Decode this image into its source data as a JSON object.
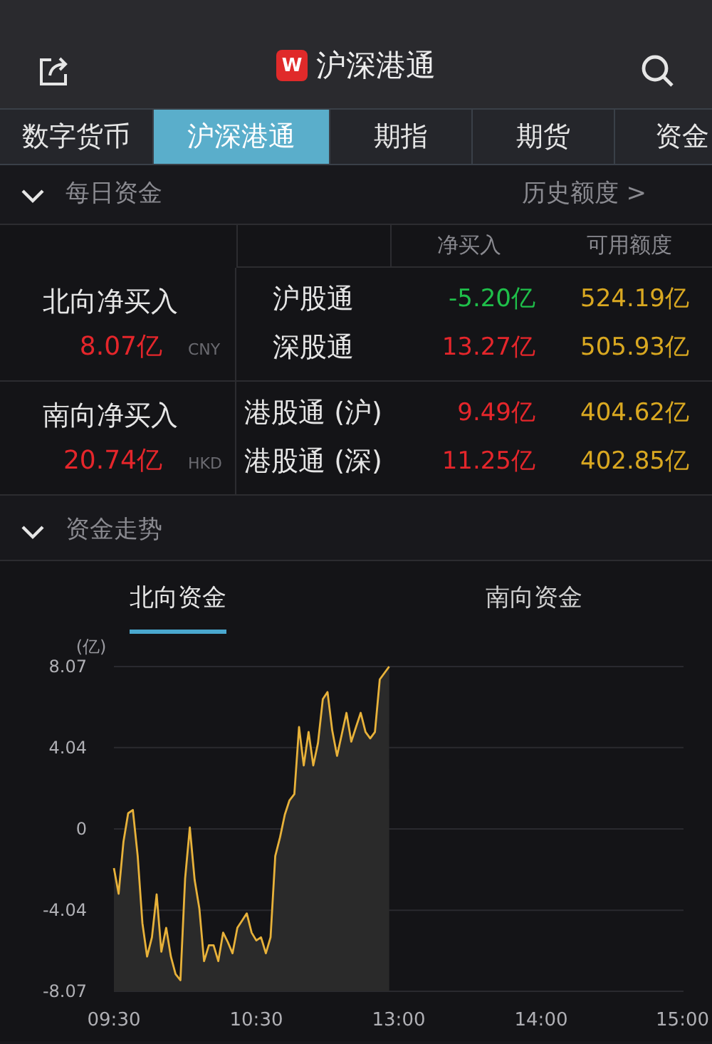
{
  "header": {
    "app_badge": "W",
    "title": "沪深港通"
  },
  "tabs": [
    {
      "label": "数字货币",
      "selected": false
    },
    {
      "label": "沪深港通",
      "selected": true
    },
    {
      "label": "期指",
      "selected": false
    },
    {
      "label": "期货",
      "selected": false
    },
    {
      "label": "资金",
      "selected": false
    }
  ],
  "daily_funds": {
    "title": "每日资金",
    "expanded": true,
    "link": "历史额度 >",
    "columns": [
      "净买入",
      "可用额度"
    ],
    "groups": [
      {
        "label": "北向净买入",
        "amount": "8.07亿",
        "currency": "CNY",
        "rows": [
          {
            "name": "沪股通",
            "net": "-5.20亿",
            "color": "#1fbf4a",
            "quota": "524.19亿"
          },
          {
            "name": "深股通",
            "net": "13.27亿",
            "color": "#e5262b",
            "quota": "505.93亿"
          }
        ]
      },
      {
        "label": "南向净买入",
        "amount": "20.74亿",
        "currency": "HKD",
        "rows": [
          {
            "name": "港股通 (沪)",
            "net": "9.49亿",
            "color": "#e5262b",
            "quota": "404.62亿"
          },
          {
            "name": "港股通 (深)",
            "net": "11.25亿",
            "color": "#e5262b",
            "quota": "402.85亿"
          }
        ]
      }
    ]
  },
  "fund_trend": {
    "title": "资金走势",
    "expanded": true,
    "tabs": [
      {
        "label": "北向资金",
        "selected": true
      },
      {
        "label": "南向资金",
        "selected": false
      }
    ],
    "chart_data": {
      "type": "line",
      "ylabel": "(亿)",
      "categories": [
        "09:30",
        null,
        null,
        null,
        null,
        null,
        null,
        null,
        null,
        null,
        null,
        null,
        null,
        null,
        null,
        null,
        null,
        null,
        null,
        null,
        null,
        null,
        null,
        null,
        null,
        null,
        null,
        null,
        null,
        null,
        "10:30",
        null,
        null,
        null,
        null,
        null,
        null,
        null,
        null,
        null,
        null,
        null,
        null,
        null,
        null,
        null,
        null,
        null,
        null,
        null,
        null,
        null,
        null,
        null,
        null,
        null,
        null,
        null,
        null,
        null,
        "13:00",
        null,
        null,
        null,
        null,
        null,
        null,
        null,
        null,
        null,
        null,
        null,
        null,
        null,
        null,
        null,
        null,
        null,
        null,
        null,
        null,
        null,
        null,
        null,
        null,
        null,
        null,
        null,
        null,
        null,
        "14:00",
        null,
        null,
        null,
        null,
        null,
        null,
        null,
        null,
        null,
        null,
        null,
        null,
        null,
        null,
        null,
        null,
        null,
        null,
        null,
        null,
        null,
        null,
        null,
        null,
        null,
        null,
        null,
        null,
        null,
        "15:00"
      ],
      "series": [
        {
          "color": "#e8b23a",
          "values": [
            -1.95,
            -3.22,
            -0.64,
            0.78,
            0.94,
            -1.35,
            -4.68,
            -6.34,
            -5.39,
            -3.25,
            -6.1,
            -4.91,
            -6.34,
            -7.21,
            -7.52,
            -2.46,
            0.07,
            -2.54,
            -3.96,
            -6.57,
            -5.78,
            -5.78,
            -6.57,
            -5.15,
            -5.63,
            -6.18,
            -4.91,
            -4.56,
            -4.2,
            -5.15,
            -5.54,
            -5.39,
            -6.18,
            -5.39,
            -1.35,
            -0.4,
            0.71,
            1.42,
            1.73,
            5.06,
            3.16,
            4.82,
            3.16,
            4.27,
            6.45,
            6.8,
            4.9,
            3.63,
            4.7,
            5.77,
            4.34,
            5.06,
            5.77,
            4.82,
            4.5,
            4.82,
            7.43,
            7.75,
            8.07,
            null,
            null,
            null,
            null,
            null,
            null,
            null,
            null,
            null,
            null,
            null,
            null,
            null,
            null,
            null,
            null,
            null,
            null,
            null,
            null,
            null,
            null,
            null,
            null,
            null,
            null,
            null,
            null,
            null,
            null,
            null,
            null,
            null,
            null,
            null,
            null,
            null,
            null,
            null,
            null,
            null,
            null,
            null,
            null,
            null,
            null,
            null,
            null,
            null,
            null,
            null,
            null,
            null,
            null,
            null,
            null,
            null,
            null,
            null,
            null,
            null,
            null
          ]
        }
      ],
      "ylim": [
        -8.07,
        8.07
      ],
      "grid": true,
      "yticks": [
        {
          "value": 8.07,
          "label": "8.07"
        },
        {
          "value": 4.04,
          "label": "4.04"
        },
        {
          "value": 0,
          "label": "0"
        },
        {
          "value": -4.04,
          "label": "-4.04"
        },
        {
          "value": -8.07,
          "label": "-8.07"
        }
      ]
    }
  }
}
